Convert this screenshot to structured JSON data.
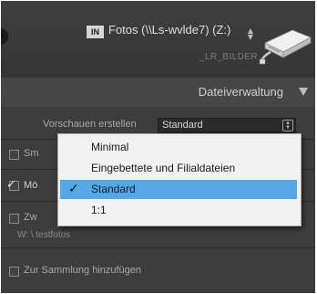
{
  "source": {
    "badge": "IN",
    "label": "Fotos (\\\\Ls-wvlde7) (Z:)",
    "sublabel": "_LR_BILDER"
  },
  "panel": {
    "title": "Dateiverwaltung"
  },
  "rows": {
    "previews_label": "Vorschauen erstellen",
    "previews_value": "Standard",
    "row2_label": "Sm",
    "row3_label": "Mö",
    "row4_label": "Zw",
    "row4_path": "W: \\ testfotos",
    "row5_label": "Zur Sammlung hinzufügen"
  },
  "menu": {
    "items": [
      {
        "label": "Minimal",
        "selected": false
      },
      {
        "label": "Eingebettete und Filialdateien",
        "selected": false
      },
      {
        "label": "Standard",
        "selected": true
      },
      {
        "label": "1:1",
        "selected": false
      }
    ],
    "check_glyph": "✓"
  },
  "colors": {
    "selection": "#55a7e6",
    "panel_bg": "#3a3a3a"
  }
}
